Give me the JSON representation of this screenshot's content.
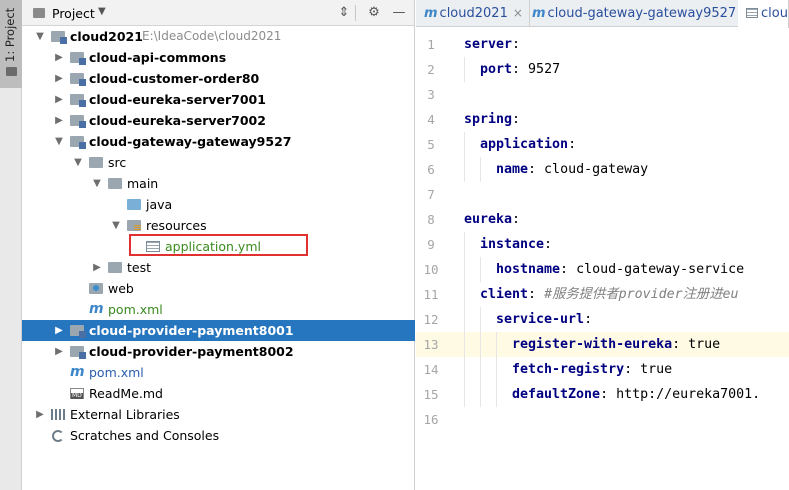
{
  "tool_strip": {
    "project_tab": "1: Project"
  },
  "panel": {
    "title": "Project",
    "buttons": {
      "collapse": "⇕",
      "settings": "⚙",
      "hide": "—"
    }
  },
  "tree": [
    {
      "name": "cloud2021",
      "path": "E:\\IdeaCode\\cloud2021",
      "depth": 0,
      "arrow": "▼",
      "icon": "module-folder-icon",
      "bold": true
    },
    {
      "name": "cloud-api-commons",
      "depth": 1,
      "arrow": "▶",
      "icon": "module-folder-icon",
      "bold": true
    },
    {
      "name": "cloud-customer-order80",
      "depth": 1,
      "arrow": "▶",
      "icon": "module-folder-icon",
      "bold": true
    },
    {
      "name": "cloud-eureka-server7001",
      "depth": 1,
      "arrow": "▶",
      "icon": "module-folder-icon",
      "bold": true
    },
    {
      "name": "cloud-eureka-server7002",
      "depth": 1,
      "arrow": "▶",
      "icon": "module-folder-icon",
      "bold": true
    },
    {
      "name": "cloud-gateway-gateway9527",
      "depth": 1,
      "arrow": "▼",
      "icon": "module-folder-icon",
      "bold": true
    },
    {
      "name": "src",
      "depth": 2,
      "arrow": "▼",
      "icon": "folder-icon"
    },
    {
      "name": "main",
      "depth": 3,
      "arrow": "▼",
      "icon": "folder-icon"
    },
    {
      "name": "java",
      "depth": 4,
      "arrow": "",
      "icon": "java-source-folder-icon"
    },
    {
      "name": "resources",
      "depth": 4,
      "arrow": "▼",
      "icon": "resources-folder-icon"
    },
    {
      "name": "application.yml",
      "depth": 5,
      "arrow": "",
      "icon": "yml-file-icon",
      "color": "green",
      "boxed": true
    },
    {
      "name": "test",
      "depth": 3,
      "arrow": "▶",
      "icon": "folder-icon"
    },
    {
      "name": "web",
      "depth": 2,
      "arrow": "",
      "icon": "web-folder-icon"
    },
    {
      "name": "pom.xml",
      "depth": 2,
      "arrow": "",
      "icon": "maven-icon",
      "color": "green"
    },
    {
      "name": "cloud-provider-payment8001",
      "depth": 1,
      "arrow": "▶",
      "icon": "module-folder-icon",
      "bold": true,
      "selected": true
    },
    {
      "name": "cloud-provider-payment8002",
      "depth": 1,
      "arrow": "▶",
      "icon": "module-folder-icon",
      "bold": true
    },
    {
      "name": "pom.xml",
      "depth": 1,
      "arrow": "",
      "icon": "maven-icon",
      "color": "blue"
    },
    {
      "name": "ReadMe.md",
      "depth": 1,
      "arrow": "",
      "icon": "markdown-file-icon"
    },
    {
      "name": "External Libraries",
      "depth": 0,
      "arrow": "▶",
      "icon": "libraries-icon"
    },
    {
      "name": "Scratches and Consoles",
      "depth": 0,
      "arrow": "",
      "icon": "scratches-icon"
    }
  ],
  "editor": {
    "tabs": [
      {
        "label": "cloud2021",
        "icon": "maven-icon",
        "close": "×"
      },
      {
        "label": "cloud-gateway-gateway9527",
        "icon": "maven-icon",
        "close": "×"
      },
      {
        "label": "clou",
        "icon": "yml-file-icon",
        "active": true
      }
    ],
    "highlighted_line": 13,
    "lines": [
      {
        "n": "1",
        "indent": 0,
        "key": "server",
        "sep": ":",
        "val": ""
      },
      {
        "n": "2",
        "indent": 1,
        "key": "port",
        "sep": ":",
        "val": " 9527"
      },
      {
        "n": "3",
        "indent": 0,
        "key": "",
        "sep": "",
        "val": ""
      },
      {
        "n": "4",
        "indent": 0,
        "key": "spring",
        "sep": ":",
        "val": ""
      },
      {
        "n": "5",
        "indent": 1,
        "key": "application",
        "sep": ":",
        "val": ""
      },
      {
        "n": "6",
        "indent": 2,
        "key": "name",
        "sep": ":",
        "val": " cloud-gateway"
      },
      {
        "n": "7",
        "indent": 0,
        "key": "",
        "sep": "",
        "val": ""
      },
      {
        "n": "8",
        "indent": 0,
        "key": "eureka",
        "sep": ":",
        "val": ""
      },
      {
        "n": "9",
        "indent": 1,
        "key": "instance",
        "sep": ":",
        "val": ""
      },
      {
        "n": "10",
        "indent": 2,
        "key": "hostname",
        "sep": ":",
        "val": " cloud-gateway-service"
      },
      {
        "n": "11",
        "indent": 1,
        "key": "client",
        "sep": ":",
        "val": " ",
        "comment": "#服务提供者provider注册进eu"
      },
      {
        "n": "12",
        "indent": 2,
        "key": "service-url",
        "sep": ":",
        "val": ""
      },
      {
        "n": "13",
        "indent": 3,
        "key": "register-with-eureka",
        "sep": ":",
        "val": " true"
      },
      {
        "n": "14",
        "indent": 3,
        "key": "fetch-registry",
        "sep": ":",
        "val": " true"
      },
      {
        "n": "15",
        "indent": 3,
        "key": "defaultZone",
        "sep": ":",
        "val": " http://eureka7001."
      },
      {
        "n": "16",
        "indent": 0,
        "key": "",
        "sep": "",
        "val": ""
      }
    ]
  }
}
